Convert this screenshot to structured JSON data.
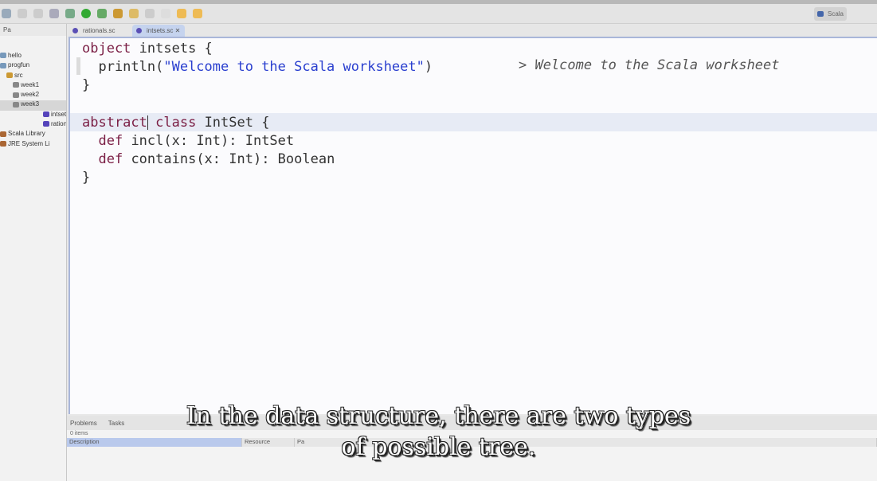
{
  "perspective": {
    "label": "Scala"
  },
  "sidebar": {
    "header": "Pa",
    "tree": [
      {
        "label": "hello",
        "level": 0
      },
      {
        "label": "progfun",
        "level": 0
      },
      {
        "label": "src",
        "level": 1
      },
      {
        "label": "week1",
        "level": 2
      },
      {
        "label": "week2",
        "level": 2
      },
      {
        "label": "week3",
        "level": 2,
        "selected": true
      },
      {
        "label": "intsets.",
        "level": 3
      },
      {
        "label": "rational",
        "level": 3
      },
      {
        "label": "Scala Library",
        "level": 0
      },
      {
        "label": "JRE System Li",
        "level": 0
      }
    ]
  },
  "tabs": [
    {
      "label": "rationals.sc",
      "active": false
    },
    {
      "label": "intsets.sc",
      "active": true
    }
  ],
  "editor": {
    "lines": [
      [
        {
          "t": "object",
          "k": "kw"
        },
        {
          "t": " intsets {"
        }
      ],
      [
        {
          "t": "  println("
        },
        {
          "t": "\"Welcome to the Scala worksheet\"",
          "k": "str"
        },
        {
          "t": ")"
        }
      ],
      [
        {
          "t": "}"
        }
      ],
      [
        {
          "t": ""
        }
      ],
      [
        {
          "t": "abstract",
          "k": "kw"
        },
        {
          "t": "|caret|"
        },
        {
          "t": " "
        },
        {
          "t": "class",
          "k": "kw"
        },
        {
          "t": " IntSet {"
        }
      ],
      [
        {
          "t": "  "
        },
        {
          "t": "def",
          "k": "kw"
        },
        {
          "t": " incl(x: Int): IntSet"
        }
      ],
      [
        {
          "t": "  "
        },
        {
          "t": "def",
          "k": "kw"
        },
        {
          "t": " contains(x: Int): Boolean"
        }
      ],
      [
        {
          "t": "}"
        }
      ]
    ],
    "worksheet_result": "> Welcome to the Scala worksheet"
  },
  "panel": {
    "tabs": [
      "Problems",
      "Tasks"
    ],
    "count": "0 items",
    "columns": [
      "Description",
      "Resource",
      "Pa"
    ]
  },
  "subtitle": {
    "line1": "In the data structure, there are two types",
    "line2": "of possible tree."
  }
}
